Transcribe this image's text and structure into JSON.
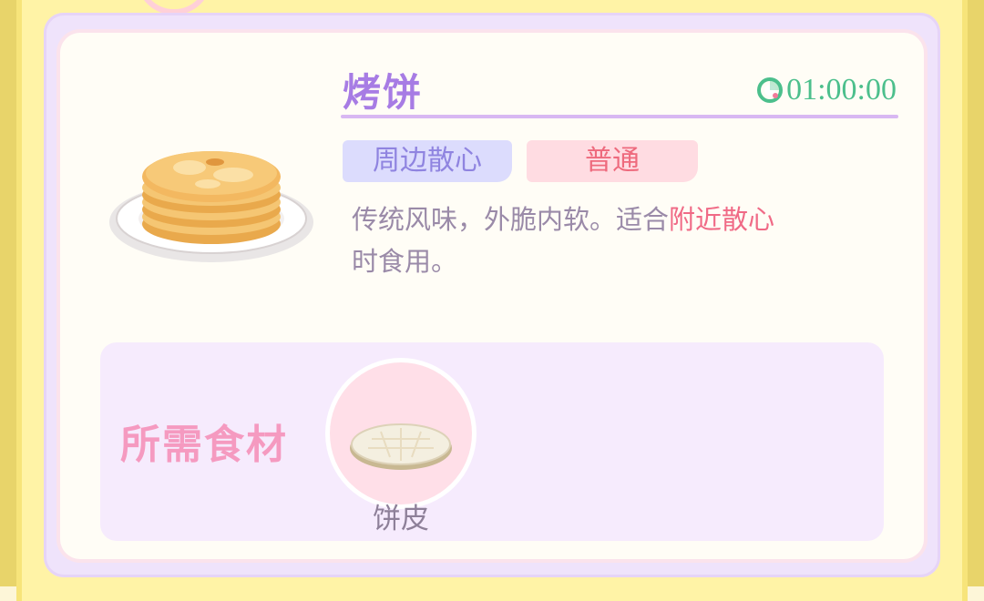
{
  "recipe": {
    "name": "烤饼",
    "timer": "01:00:00",
    "tags": {
      "category": "周边散心",
      "quality": "普通"
    },
    "description": {
      "part1": "传统风味，外脆内软。适合",
      "highlight": "附近散心",
      "part2": "时食用。"
    },
    "dish_icon": "pancake-stack-icon"
  },
  "ingredients": {
    "label": "所需食材",
    "items": [
      {
        "name": "饼皮",
        "icon": "flatbread-icon"
      }
    ]
  },
  "colors": {
    "title": "#a77ce4",
    "timer": "#4cbf8c",
    "category_tag_bg": "#dcdcfd",
    "category_tag_text": "#8f84e0",
    "quality_tag_bg": "#ffdce2",
    "quality_tag_text": "#ee6a7d",
    "highlight": "#f06a86",
    "ingredients_label": "#f59ac0"
  }
}
